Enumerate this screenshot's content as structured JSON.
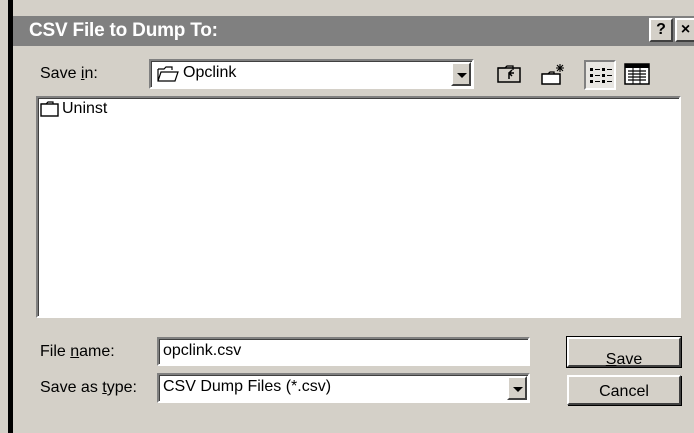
{
  "dialog": {
    "title": "CSV File to Dump To:",
    "help_label": "?",
    "close_label": "×"
  },
  "save_in": {
    "label_pre": "Save ",
    "label_accel": "i",
    "label_post": "n:",
    "value": "Opclink",
    "icon": "folder-open-icon"
  },
  "toolbar": {
    "up_icon": "up-one-level-icon",
    "new_folder_icon": "new-folder-icon",
    "list_icon": "list-view-icon",
    "details_icon": "details-view-icon"
  },
  "file_list": {
    "items": [
      {
        "name": "Uninst",
        "icon": "folder-icon"
      }
    ]
  },
  "file_name": {
    "label_pre": "File ",
    "label_accel": "n",
    "label_post": "ame:",
    "value": "opclink.csv"
  },
  "save_as_type": {
    "label_pre": "Save as ",
    "label_accel": "t",
    "label_post": "ype:",
    "value": "CSV Dump Files (*.csv)"
  },
  "buttons": {
    "save_accel": "S",
    "save_rest": "ave",
    "cancel": "Cancel"
  },
  "colors": {
    "face": "#d4d0c8",
    "titlebar": "#808080",
    "title_text": "#ffffff"
  }
}
